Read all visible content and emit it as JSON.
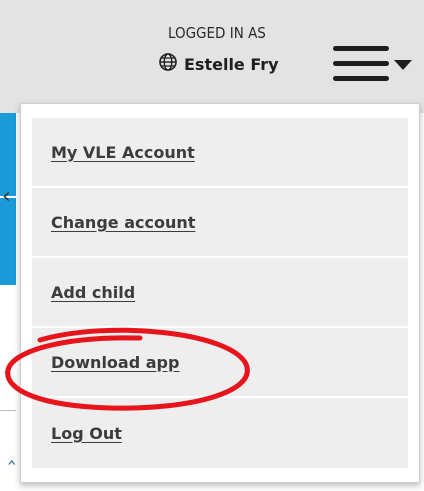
{
  "header": {
    "logged_in_label": "LOGGED IN AS",
    "user_name": "Estelle Fry",
    "user_icon": "globe-icon",
    "menu_icon": "hamburger-icon",
    "menu_caret_icon": "caret-down-icon"
  },
  "menu": {
    "items": [
      {
        "label": "My VLE Account"
      },
      {
        "label": "Change account"
      },
      {
        "label": "Add child"
      },
      {
        "label": "Download app"
      },
      {
        "label": "Log Out"
      }
    ],
    "highlighted_item": "Download app"
  },
  "colors": {
    "header_bg": "#e3e3e3",
    "menu_item_bg": "#eeeeee",
    "accent_blue": "#1a9ad6",
    "annotation_red": "#e8141c",
    "text_dark": "#3c3c3c"
  }
}
